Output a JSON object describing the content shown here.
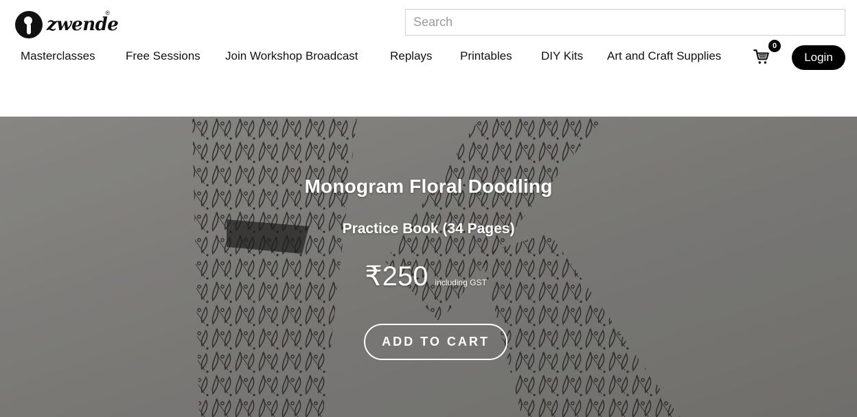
{
  "header": {
    "logo_text": "zwende",
    "logo_reg": "®",
    "search": {
      "placeholder": "Search",
      "value": ""
    },
    "nav": [
      "Masterclasses",
      "Free Sessions",
      "Join Workshop Broadcast",
      "Replays",
      "Printables",
      "DIY Kits",
      "Art and Craft Supplies"
    ],
    "cart_count": "0",
    "login_label": "Login"
  },
  "hero": {
    "title": "Monogram Floral Doodling",
    "subtitle": "Practice Book (34 Pages)",
    "price": "₹250",
    "price_note": "including GST",
    "cta_label": "ADD TO CART"
  },
  "colors": {
    "primary": "#000000",
    "hero_background": "#8c8b88",
    "text_on_hero": "#ffffff"
  }
}
